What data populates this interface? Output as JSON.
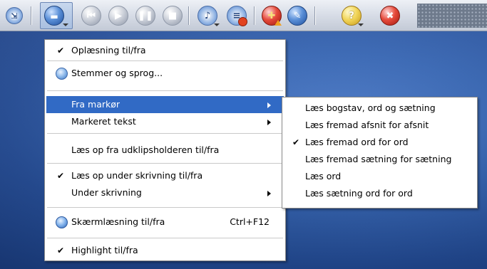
{
  "toolbar": {
    "buttons": [
      {
        "name": "restore-icon"
      },
      {
        "name": "speech-dropdown-icon"
      },
      {
        "name": "previous-icon"
      },
      {
        "name": "play-icon"
      },
      {
        "name": "pause-icon"
      },
      {
        "name": "stop-icon"
      },
      {
        "name": "audio-file-icon"
      },
      {
        "name": "record-icon"
      },
      {
        "name": "dictionary-icon"
      },
      {
        "name": "settings-icon"
      },
      {
        "name": "help-icon"
      },
      {
        "name": "close-icon"
      }
    ]
  },
  "menu": {
    "items": {
      "toggle_reading": {
        "label": "Oplæsning til/fra",
        "checked": "✔"
      },
      "voices": {
        "label": "Stemmer og sprog..."
      },
      "from_cursor": {
        "label": "Fra markør"
      },
      "selected_text": {
        "label": "Markeret tekst"
      },
      "clipboard": {
        "label": "Læs op fra udklipsholderen til/fra"
      },
      "while_typing_toggle": {
        "label": "Læs op under skrivning til/fra",
        "checked": "✔"
      },
      "while_typing": {
        "label": "Under skrivning"
      },
      "screen_reading": {
        "label": "Skærmlæsning til/fra",
        "shortcut": "Ctrl+F12"
      },
      "highlight": {
        "label": "Highlight til/fra",
        "checked": "✔"
      }
    }
  },
  "submenu": {
    "items": [
      {
        "label": "Læs bogstav, ord og sætning",
        "checked": ""
      },
      {
        "label": "Læs fremad afsnit for afsnit",
        "checked": ""
      },
      {
        "label": "Læs fremad ord for ord",
        "checked": "✔"
      },
      {
        "label": "Læs fremad sætning for sætning",
        "checked": ""
      },
      {
        "label": "Læs ord",
        "checked": ""
      },
      {
        "label": "Læs sætning ord for ord",
        "checked": ""
      }
    ]
  },
  "colors": {
    "highlight": "#316ac5",
    "desktop": "#2f5aa0",
    "toolbar": "#d9dee8"
  }
}
